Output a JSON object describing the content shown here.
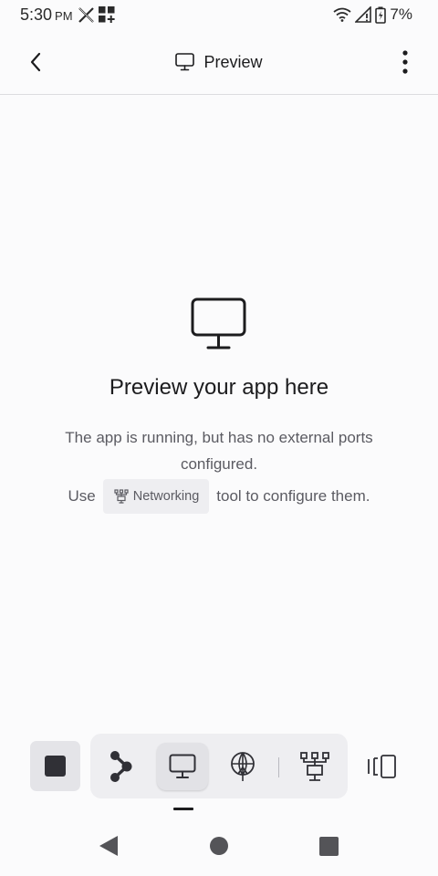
{
  "status_bar": {
    "time": "5:30",
    "ampm": "PM",
    "battery": "7%",
    "icons": [
      "x-logo-icon",
      "apps-grid-icon",
      "wifi-icon",
      "signal-icon",
      "battery-icon"
    ]
  },
  "header": {
    "title": "Preview",
    "back_icon": "chevron-left-icon",
    "menu_icon": "more-vertical-icon"
  },
  "empty_state": {
    "icon": "monitor-icon",
    "title": "Preview your app here",
    "description": "The app is running, but has no external ports configured.",
    "use_prefix": "Use",
    "tool_name": "Networking",
    "use_suffix": "tool to configure them."
  },
  "toolbar": {
    "stop": "stop-icon",
    "tools": [
      {
        "icon": "workflow-icon",
        "active": false
      },
      {
        "icon": "monitor-icon",
        "active": true
      },
      {
        "icon": "deploy-icon",
        "active": false
      },
      {
        "icon": "networking-icon",
        "active": false
      }
    ],
    "layout": "split-layout-icon"
  },
  "nav_bar": {
    "buttons": [
      "back",
      "home",
      "recents"
    ]
  },
  "colors": {
    "background": "#fbfbfc",
    "text_primary": "#1c1c1e",
    "text_secondary": "#5b5b62",
    "chip_bg": "#eeeef1"
  }
}
